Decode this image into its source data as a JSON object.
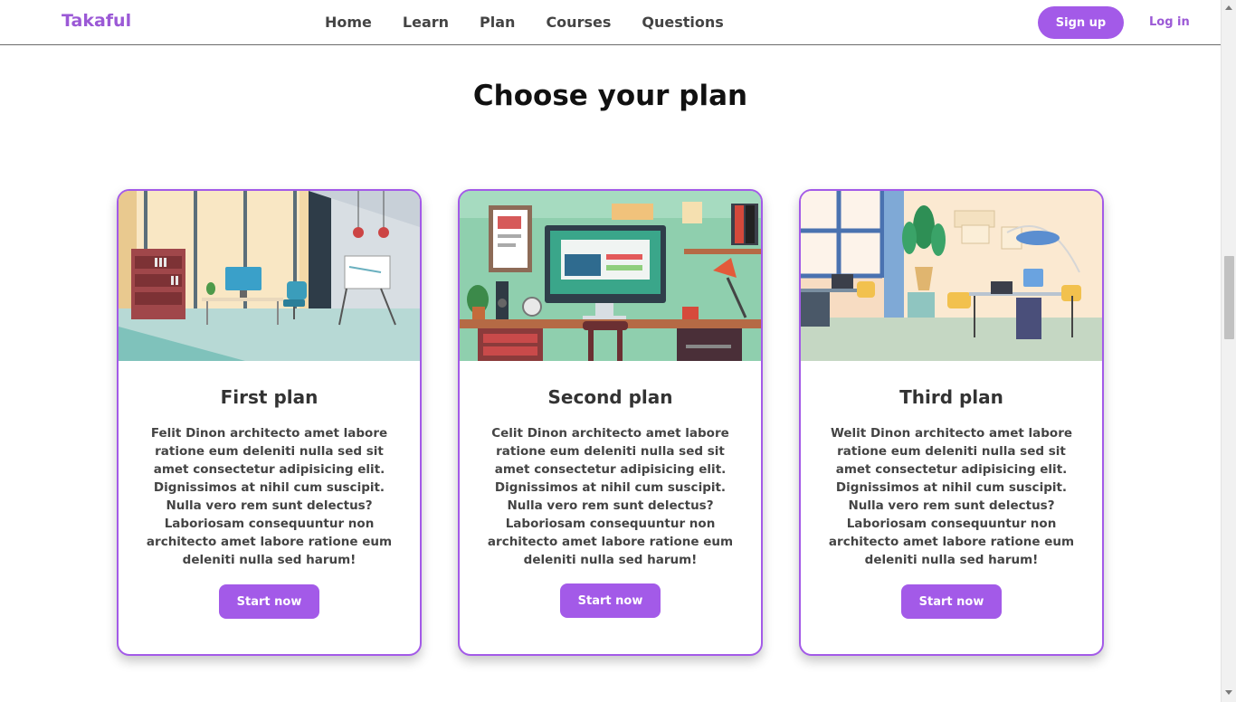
{
  "header": {
    "logo": "Takaful",
    "nav": [
      "Home",
      "Learn",
      "Plan",
      "Courses",
      "Questions"
    ],
    "signup_label": "Sign up",
    "login_label": "Log in"
  },
  "section_title": "Choose your plan",
  "plans": [
    {
      "title": "First plan",
      "text": "Felit Dinon architecto amet labore ratione eum deleniti nulla sed sit amet consectetur adipisicing elit. Dignissimos at nihil cum suscipit. Nulla vero rem sunt delectus? Laboriosam consequuntur non architecto amet labore ratione eum deleniti nulla sed harum!",
      "button": "Start now"
    },
    {
      "title": "Second plan",
      "text": "Celit Dinon architecto amet labore ratione eum deleniti nulla sed sit amet consectetur adipisicing elit. Dignissimos at nihil cum suscipit. Nulla vero rem sunt delectus? Laboriosam consequuntur non architecto amet labore ratione eum deleniti nulla sed harum!",
      "button": "Start now"
    },
    {
      "title": "Third plan",
      "text": "Welit Dinon architecto amet labore ratione eum deleniti nulla sed sit amet consectetur adipisicing elit. Dignissimos at nihil cum suscipit. Nulla vero rem sunt delectus? Laboriosam consequuntur non architecto amet labore ratione eum deleniti nulla sed harum!",
      "button": "Start now"
    }
  ],
  "colors": {
    "accent": "#a35ae8",
    "logo": "#9b59d6",
    "nav_text": "#444444"
  }
}
